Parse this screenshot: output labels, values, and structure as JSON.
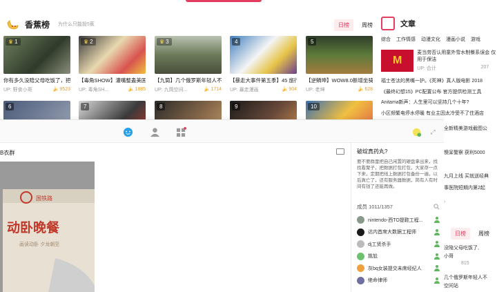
{
  "ranking": {
    "title": "香蕉榜",
    "hint": "为什么只能投5蕉",
    "tabs": [
      "日榜",
      "周榜"
    ],
    "active_tab": "日榜",
    "videos": [
      {
        "rank": "1",
        "title": "你有多久没陪父母吃饭了，把",
        "up": "UP: 野食小哥",
        "bananas": "9523"
      },
      {
        "rank": "2",
        "title": "【毒角SHOW】灌嘴整蛊美国界",
        "up": "UP: 毒角SH...",
        "bananas": "1885"
      },
      {
        "rank": "3",
        "title": "【九筒】几个俄罗斯年轻人不远",
        "up": "UP: 九筒空间...",
        "bananas": "1714"
      },
      {
        "rank": "4",
        "title": "【暴走大事件第五季】45 旅行",
        "up": "UP: 暴走漫画",
        "bananas": "904"
      },
      {
        "rank": "5",
        "title": "【逆鳞坤】WOW8.0新增坐骑展",
        "up": "UP: 老坤",
        "bananas": "628"
      },
      {
        "rank": "6"
      },
      {
        "rank": "7"
      },
      {
        "rank": "8"
      },
      {
        "rank": "9"
      },
      {
        "rank": "10"
      }
    ]
  },
  "articles": {
    "title": "文章",
    "tabs": [
      "综合",
      "工作情感",
      "动漫文化",
      "漫画小说",
      "游戏"
    ],
    "featured": {
      "text": "麦当劳否认用童外雪水制餐系误会 仅用于保洁",
      "up": "UP: 合计",
      "comments": "207"
    },
    "items": [
      "福士苍汰的黑嘴一护。《死神》真人版电影  2018",
      "《最终幻想15》PC配置公布 官方提供检测工具",
      "Anitama新声：人生里可以坚持几个十年?",
      "小区频繁电停水停暖 有业主因太冷受不了住酒店"
    ]
  },
  "chat": {
    "room_name": "B衣群",
    "notice_title": "破绽真药丸?",
    "notice_body": "要不要群里把自己闲置的硬盘拿出来，找找看聚子，把数据打包打包，大家存一点下来，定期把线上数据打包备份一遍，以后真亡了，还有服务器数据，简有人有时间有钱了还能再做。",
    "member_label": "成员 1011/1357",
    "members": [
      {
        "name": "nintendo-西TO提鞋工程...",
        "color": "#8a9a8a"
      },
      {
        "name": "达内首席大数据工程师",
        "color": "#1a1a1a"
      },
      {
        "name": "dj工贤杀手",
        "color": "#bbbbbb"
      },
      {
        "name": "尴尬",
        "color": "#6cc070"
      },
      {
        "name": "灰bq女装提交未席经纪人",
        "color": "#f0a040"
      },
      {
        "name": "绝命律师",
        "color": "#7070a0"
      }
    ]
  },
  "right_strip": {
    "items": [
      "全新精美游戏截图公",
      "懊呆警察  获利5000",
      "九月上线  买就送经典",
      "事医院短期内第2起"
    ],
    "tabs": [
      "日榜",
      "周榜"
    ],
    "bottom_items": [
      "没陪父母吃饭了,",
      "小哥",
      "815",
      "几个俄罗斯年轻人不",
      "空间站"
    ]
  },
  "colors": {
    "accent": "#e23c5f",
    "banana": "#f39c11",
    "online": "#5cb85c"
  }
}
